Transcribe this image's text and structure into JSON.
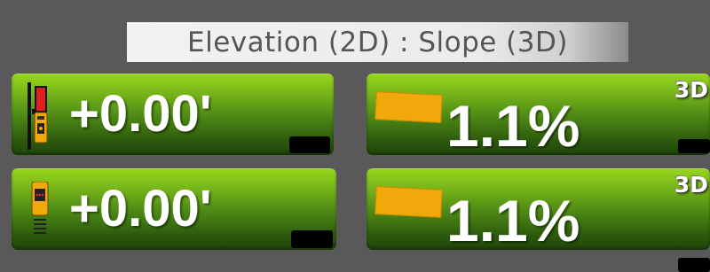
{
  "header": {
    "title": "Elevation (2D) : Slope (3D)"
  },
  "elevation_panels": [
    {
      "value": "+0.00'",
      "icon": "rod-laser-receiver-icon"
    },
    {
      "value": "+0.00'",
      "icon": "receiver-unit-icon"
    }
  ],
  "slope_panels": [
    {
      "value": "1.1%",
      "badge": "3D",
      "icon": "slope-bar-icon"
    },
    {
      "value": "1.1%",
      "badge": "3D",
      "icon": "slope-bar-icon"
    }
  ],
  "colors": {
    "background": "#595959",
    "panel_green_top": "#98d81c",
    "panel_green_bottom": "#1f460a",
    "slope_bar": "#f0a80a",
    "receiver_orange": "#f0a80a",
    "receiver_red": "#e02020"
  }
}
